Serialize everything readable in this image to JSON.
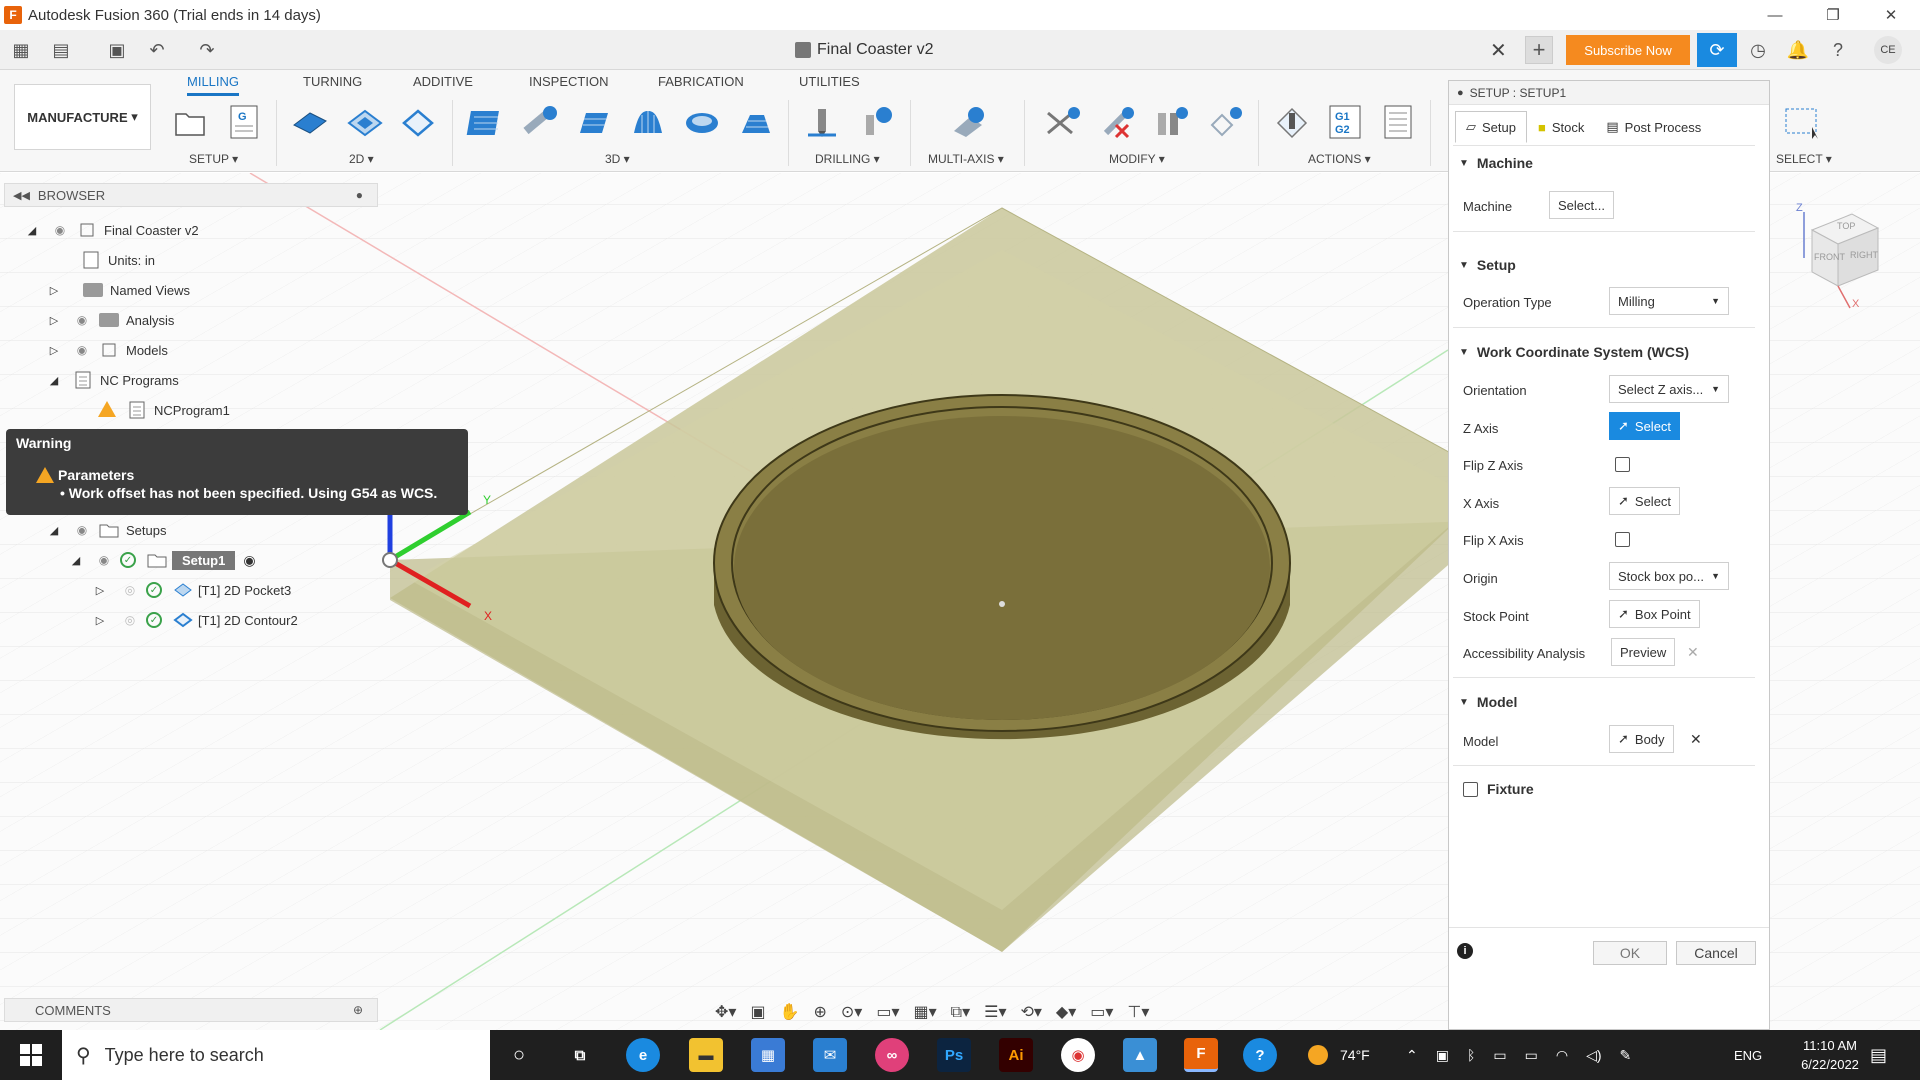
{
  "window": {
    "title": "Autodesk Fusion 360 (Trial ends in 14 days)"
  },
  "document": {
    "tab_title": "Final Coaster v2"
  },
  "header": {
    "subscribe_label": "Subscribe Now",
    "avatar_initials": "CE"
  },
  "ribbon": {
    "workspace": "MANUFACTURE",
    "tabs": [
      "MILLING",
      "TURNING",
      "ADDITIVE",
      "INSPECTION",
      "FABRICATION",
      "UTILITIES"
    ],
    "groups": [
      "SETUP ▾",
      "2D ▾",
      "3D ▾",
      "DRILLING ▾",
      "MULTI-AXIS ▾",
      "MODIFY ▾",
      "ACTIONS ▾",
      "SELECT ▾"
    ]
  },
  "browser": {
    "header": "BROWSER",
    "items": [
      {
        "label": "Final Coaster v2"
      },
      {
        "label": "Units: in"
      },
      {
        "label": "Named Views"
      },
      {
        "label": "Analysis"
      },
      {
        "label": "Models"
      },
      {
        "label": "NC Programs"
      },
      {
        "label": "NCProgram1"
      },
      {
        "label": "Setups"
      },
      {
        "label": "Setup1"
      },
      {
        "label": "[T1] 2D Pocket3"
      },
      {
        "label": "[T1] 2D Contour2"
      }
    ]
  },
  "warning": {
    "title": "Warning",
    "heading": "Parameters",
    "message": "• Work offset has not been specified. Using G54 as WCS."
  },
  "comments": {
    "label": "COMMENTS"
  },
  "setup_dialog": {
    "title": "SETUP : SETUP1",
    "tabs": [
      "Setup",
      "Stock",
      "Post Process"
    ],
    "machine_section": "Machine",
    "machine_label": "Machine",
    "machine_value": "Select...",
    "setup_section": "Setup",
    "operation_type_label": "Operation Type",
    "operation_type_value": "Milling",
    "wcs_section": "Work Coordinate System (WCS)",
    "orientation_label": "Orientation",
    "orientation_value": "Select Z axis...",
    "z_axis_label": "Z Axis",
    "z_axis_value": "Select",
    "flip_z_label": "Flip Z Axis",
    "x_axis_label": "X Axis",
    "x_axis_value": "Select",
    "flip_x_label": "Flip X Axis",
    "origin_label": "Origin",
    "origin_value": "Stock box po...",
    "stock_point_label": "Stock Point",
    "stock_point_value": "Box Point",
    "accessibility_label": "Accessibility Analysis",
    "accessibility_value": "Preview",
    "model_section": "Model",
    "model_label": "Model",
    "model_value": "Body",
    "fixture_section": "Fixture",
    "ok_label": "OK",
    "cancel_label": "Cancel"
  },
  "viewcube": {
    "top": "TOP",
    "front": "FRONT",
    "right": "RIGHT",
    "axis_z": "Z",
    "axis_x": "X"
  },
  "axes": {
    "y": "Y",
    "x": "X"
  },
  "taskbar": {
    "search_placeholder": "Type here to search",
    "temperature": "74°F",
    "language": "ENG",
    "time": "11:10 AM",
    "date": "6/22/2022"
  },
  "colors": {
    "accent": "#1a76c5",
    "subscribe": "#f58a1f",
    "stock": "#c9c79a",
    "part": "#7a6f3a"
  }
}
